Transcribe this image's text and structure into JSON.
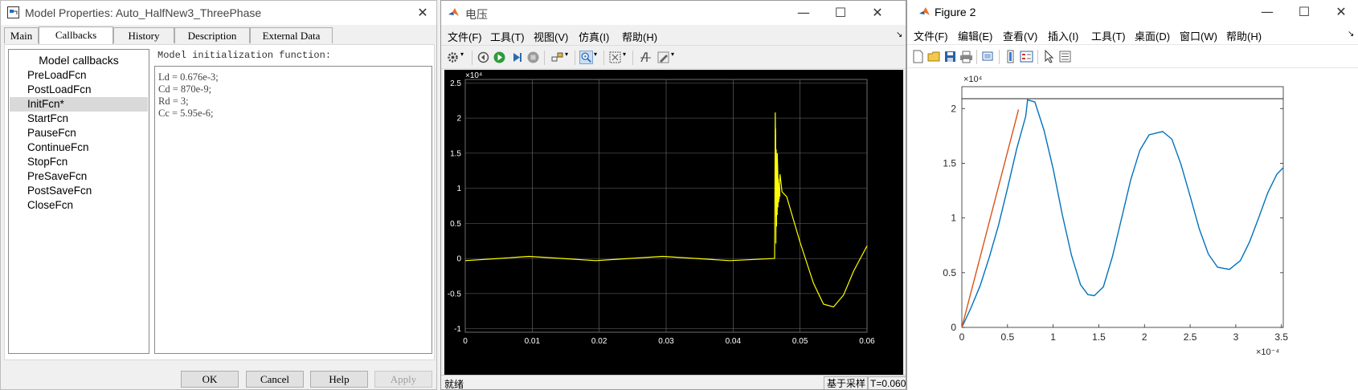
{
  "model_props": {
    "title": "Model Properties: Auto_HalfNew3_ThreePhase",
    "tabs": [
      "Main",
      "Callbacks",
      "History",
      "Description",
      "External Data"
    ],
    "callbacks_header": "Model callbacks",
    "callbacks": [
      "PreLoadFcn",
      "PostLoadFcn",
      "InitFcn*",
      "StartFcn",
      "PauseFcn",
      "ContinueFcn",
      "StopFcn",
      "PreSaveFcn",
      "PostSaveFcn",
      "CloseFcn"
    ],
    "selected_callback": "InitFcn*",
    "editor_label": "Model initialization function:",
    "code_lines": [
      "Ld = 0.676e-3;",
      "Cd = 870e-9;",
      "Rd = 3;",
      "Cc = 5.95e-6;"
    ],
    "buttons": {
      "ok": "OK",
      "cancel": "Cancel",
      "help": "Help",
      "apply": "Apply"
    }
  },
  "scope": {
    "title": "电压",
    "menu": [
      "文件(F)",
      "工具(T)",
      "视图(V)",
      "仿真(I)",
      "帮助(H)"
    ],
    "status_left": "就绪",
    "status_mode": "基于采样",
    "status_time": "T=0.060",
    "colors": {
      "background": "#000000",
      "trace": "#ffff00",
      "grid": "#6e6e6e",
      "axis_text": "#ffffff"
    }
  },
  "figure": {
    "title": "Figure 2",
    "menu": [
      "文件(F)",
      "编辑(E)",
      "查看(V)",
      "插入(I)",
      "工具(T)",
      "桌面(D)",
      "窗口(W)",
      "帮助(H)"
    ],
    "colors": {
      "blue": "#0072bd",
      "orange": "#d95319"
    }
  },
  "chart_data": [
    {
      "type": "line",
      "title": "",
      "xlabel": "",
      "ylabel": "",
      "xlim": [
        0,
        0.06
      ],
      "ylim": [
        -10500,
        25500
      ],
      "x_ticks": [
        "0",
        "0.01",
        "0.02",
        "0.03",
        "0.04",
        "0.05",
        "0.06"
      ],
      "y_ticks": [
        "-1",
        "-0.5",
        "0",
        "0.5",
        "1",
        "1.5",
        "2",
        "2.5"
      ],
      "y_exponent": "10^4",
      "grid": true,
      "series": [
        {
          "points": [
            [
              0,
              -300
            ],
            [
              0.005,
              0
            ],
            [
              0.0095,
              300
            ],
            [
              0.0145,
              0
            ],
            [
              0.0195,
              -300
            ],
            [
              0.0245,
              0
            ],
            [
              0.0295,
              300
            ],
            [
              0.0345,
              0
            ],
            [
              0.0395,
              -300
            ],
            [
              0.0462,
              0
            ],
            [
              0.0463,
              20800
            ],
            [
              0.0464,
              6000
            ],
            [
              0.0466,
              15000
            ],
            [
              0.0468,
              8000
            ],
            [
              0.047,
              12000
            ],
            [
              0.0473,
              9500
            ],
            [
              0.048,
              8800
            ],
            [
              0.05,
              2300
            ],
            [
              0.052,
              -3500
            ],
            [
              0.0535,
              -6500
            ],
            [
              0.055,
              -6900
            ],
            [
              0.0565,
              -5200
            ],
            [
              0.058,
              -1800
            ],
            [
              0.06,
              1800
            ]
          ]
        }
      ]
    },
    {
      "type": "line",
      "title": "",
      "xlabel": "",
      "ylabel": "",
      "xlim": [
        0,
        0.000352
      ],
      "ylim": [
        0,
        22000
      ],
      "x_ticks": [
        "0",
        "0.5",
        "1",
        "1.5",
        "2",
        "2.5",
        "3",
        "3.5"
      ],
      "x_exponent": "10^-4",
      "y_ticks": [
        "0",
        "0.5",
        "1",
        "1.5",
        "2"
      ],
      "y_exponent": "10^4",
      "grid": false,
      "series": [
        {
          "points": [
            [
              0,
              0
            ],
            [
              1e-05,
              1800
            ],
            [
              2e-05,
              3800
            ],
            [
              3e-05,
              6400
            ],
            [
              4e-05,
              9300
            ],
            [
              5e-05,
              12700
            ],
            [
              6e-05,
              16300
            ],
            [
              7e-05,
              19300
            ],
            [
              7.2e-05,
              20800
            ],
            [
              8e-05,
              20600
            ],
            [
              9e-05,
              18000
            ],
            [
              0.0001,
              14500
            ],
            [
              0.00011,
              10300
            ],
            [
              0.00012,
              6600
            ],
            [
              0.00013,
              3900
            ],
            [
              0.000138,
              3000
            ],
            [
              0.000145,
              2900
            ],
            [
              0.000155,
              3700
            ],
            [
              0.000165,
              6500
            ],
            [
              0.000175,
              10000
            ],
            [
              0.000185,
              13500
            ],
            [
              0.000195,
              16200
            ],
            [
              0.000205,
              17600
            ],
            [
              0.00022,
              17900
            ],
            [
              0.00023,
              17200
            ],
            [
              0.00024,
              14900
            ],
            [
              0.00025,
              12000
            ],
            [
              0.00026,
              9000
            ],
            [
              0.00027,
              6700
            ],
            [
              0.00028,
              5500
            ],
            [
              0.000293,
              5300
            ],
            [
              0.000305,
              6100
            ],
            [
              0.000315,
              7800
            ],
            [
              0.000325,
              10000
            ],
            [
              0.000335,
              12300
            ],
            [
              0.000345,
              14000
            ],
            [
              0.000352,
              14600
            ]
          ]
        },
        {
          "points": [
            [
              0,
              0
            ],
            [
              5.8e-05,
              18600
            ],
            [
              6.2e-05,
              19900
            ]
          ]
        },
        {
          "points": [
            [
              0,
              20900
            ],
            [
              0.000352,
              20900
            ]
          ]
        }
      ]
    }
  ]
}
